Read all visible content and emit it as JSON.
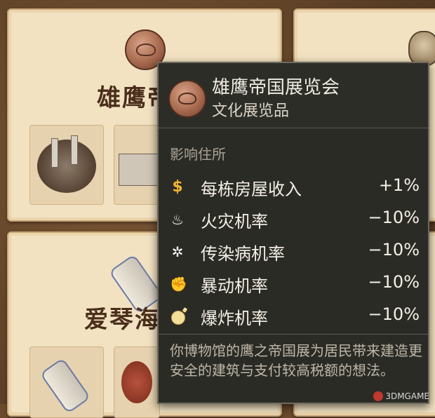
{
  "background": {
    "card_top_left_title": "雄鹰帝",
    "card_bottom_left_title": "爱琴海"
  },
  "tooltip": {
    "title": "雄鹰帝国展览会",
    "subtitle": "文化展览品",
    "section_heading": "影响住所",
    "stats": [
      {
        "icon": "coin-icon",
        "label": "每栋房屋收入",
        "value": "+1%"
      },
      {
        "icon": "fire-icon",
        "label": "火灾机率",
        "value": "−10%"
      },
      {
        "icon": "virus-icon",
        "label": "传染病机率",
        "value": "−10%"
      },
      {
        "icon": "fist-icon",
        "label": "暴动机率",
        "value": "−10%"
      },
      {
        "icon": "bomb-icon",
        "label": "爆炸机率",
        "value": "−10%"
      }
    ],
    "description": "你博物馆的鹰之帝国展为居民带来建造更安全的建筑与支付较高税额的想法。"
  },
  "watermark": {
    "text": "3DMGAME"
  },
  "colors": {
    "tooltip_bg": "#2b2b26",
    "parchment": "#f2e2c2",
    "coin": "#f2b233"
  }
}
